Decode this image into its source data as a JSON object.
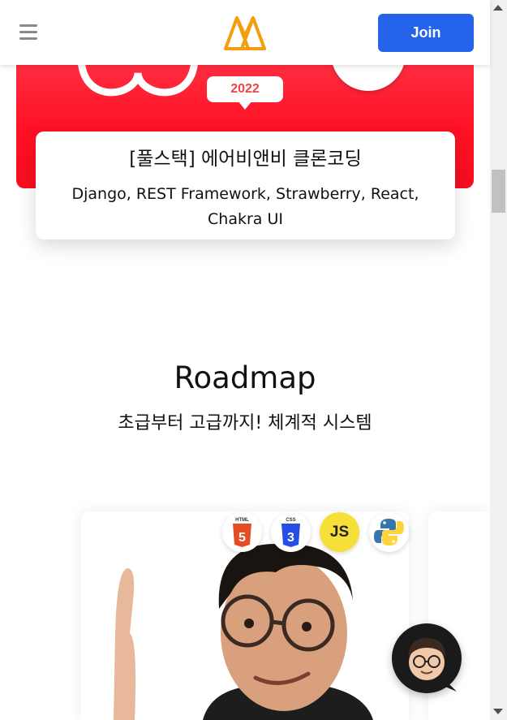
{
  "header": {
    "menu_icon": "hamburger-menu-icon",
    "logo_icon": "nomad-logo-icon",
    "join_label": "Join",
    "brand_color": "#2563eb",
    "logo_color": "#f59e0b"
  },
  "banner": {
    "year": "2022",
    "color": "#ff1023"
  },
  "course": {
    "title": "[풀스택] 에어비앤비 클론코딩",
    "subtitle": "Django, REST Framework, Strawberry, React, Chakra UI"
  },
  "roadmap": {
    "title": "Roadmap",
    "subtitle": "초급부터 고급까지! 체계적 시스템",
    "tech_icons": [
      "html5-icon",
      "css3-icon",
      "js-icon",
      "python-icon"
    ],
    "html_label": "HTML",
    "css_label": "CSS",
    "js_label": "JS"
  },
  "chat": {
    "icon": "chat-avatar-icon"
  }
}
